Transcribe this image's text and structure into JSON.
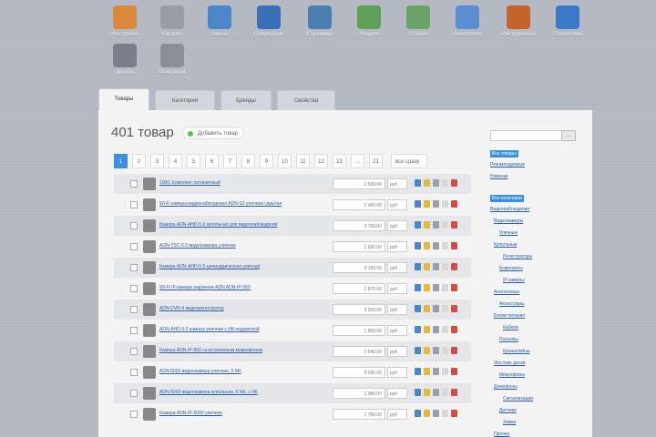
{
  "toolbar": {
    "apps": [
      {
        "label": "Настройки",
        "icon": "settings-user-icon",
        "color": "#d98a3c"
      },
      {
        "label": "Каталог",
        "icon": "catalog-box-icon",
        "color": "#9a9da5"
      },
      {
        "label": "Заказы",
        "icon": "orders-icon",
        "color": "#4a86c8"
      },
      {
        "label": "Покупатели",
        "icon": "users-icon",
        "color": "#3b6fb8"
      },
      {
        "label": "Страницы",
        "icon": "pages-icon",
        "color": "#4b7fb0"
      },
      {
        "label": "Модули",
        "icon": "modules-icon",
        "color": "#5fa05a"
      },
      {
        "label": "Статьи",
        "icon": "articles-icon",
        "color": "#6aa36a"
      },
      {
        "label": "Аналитика",
        "icon": "analytics-icon",
        "color": "#5a8ed0"
      },
      {
        "label": "Инструменты",
        "icon": "tools-icon",
        "color": "#c4642c"
      },
      {
        "label": "Статистика",
        "icon": "stats-icon",
        "color": "#3a78c8"
      },
      {
        "label": "Дизайн",
        "icon": "design-icon",
        "color": "#7a7f8c"
      },
      {
        "label": "Резервная",
        "icon": "backup-icon",
        "color": "#8a8e98"
      }
    ]
  },
  "tabs": [
    {
      "label": "Товары",
      "active": true
    },
    {
      "label": "Категории",
      "active": false
    },
    {
      "label": "Бренды",
      "active": false
    },
    {
      "label": "Свойства",
      "active": false
    }
  ],
  "main": {
    "title": "401 товар",
    "add_label": "Добавить товар",
    "pager": {
      "pages": [
        "1",
        "2",
        "3",
        "4",
        "5",
        "6",
        "7",
        "8",
        "9",
        "10",
        "11",
        "12",
        "13",
        "...",
        "21"
      ],
      "current": "1",
      "select_label": "все сразу"
    },
    "products": [
      {
        "name": "1000, Комплект гостиничный",
        "price": "1 500.00",
        "currency": "руб"
      },
      {
        "name": "Wi-Fi камера видеонаблюдения ADN-S2 уличная скрытая",
        "price": "2 490.00",
        "currency": "руб"
      },
      {
        "name": "Камера ADN-AHD-5.0 купольная для видеонаблюдения",
        "price": "3 700.00",
        "currency": "руб"
      },
      {
        "name": "ADN-YSC-5.0 видеокамера уличная",
        "price": "1 990.00",
        "currency": "руб"
      },
      {
        "name": "Камера ADN-AHD-5.0 цилиндрическая уличная",
        "price": "2 150.00",
        "currency": "руб"
      },
      {
        "name": "Wi-Fi IP камера наружная ADN ADN-IP-550",
        "price": "2 870.00",
        "currency": "руб"
      },
      {
        "name": "ADN-DVR-4 видеорегистратор",
        "price": "3 200.00",
        "currency": "руб"
      },
      {
        "name": "ADN-AHD-5.0 камера уличная с ИК-подсветкой",
        "price": "1 850.00",
        "currency": "руб"
      },
      {
        "name": "Камера ADN-IP-550 со встроенным микрофоном",
        "price": "2 640.00",
        "currency": "руб"
      },
      {
        "name": "ADN-5000 видеокамера уличная, 5 Мп",
        "price": "3 090.00",
        "currency": "руб"
      },
      {
        "name": "ADN-5000 видеокамера купольная, 5 Мп, с ИК",
        "price": "2 980.00",
        "currency": "руб"
      },
      {
        "name": "Камера ADN-IP-5000 уличная",
        "price": "1 760.00",
        "currency": "руб"
      }
    ]
  },
  "sidebar": {
    "search_placeholder": "",
    "search_button": "→",
    "groups": [
      {
        "label": "Все товары",
        "hl": true
      },
      {
        "label": "Рекомендуемые",
        "hl": false
      },
      {
        "label": "Новинки",
        "hl": false
      },
      {
        "label": "Все категории",
        "hl": true
      },
      {
        "label": "Видеонаблюдение",
        "hl": false
      },
      {
        "label": "Видеокамеры",
        "hl": false
      },
      {
        "label": "Уличные",
        "hl": false
      },
      {
        "label": "Купольные",
        "hl": false
      },
      {
        "label": "Регистраторы",
        "hl": false
      },
      {
        "label": "Комплекты",
        "hl": false
      },
      {
        "label": "IP камеры",
        "hl": false
      },
      {
        "label": "Аналоговые",
        "hl": false
      },
      {
        "label": "Аксессуары",
        "hl": false
      },
      {
        "label": "Блоки питания",
        "hl": false
      },
      {
        "label": "Кабели",
        "hl": false
      },
      {
        "label": "Разъемы",
        "hl": false
      },
      {
        "label": "Кронштейны",
        "hl": false
      },
      {
        "label": "Жесткие диски",
        "hl": false
      },
      {
        "label": "Микрофоны",
        "hl": false
      },
      {
        "label": "Домофоны",
        "hl": false
      },
      {
        "label": "Сигнализации",
        "hl": false
      },
      {
        "label": "Датчики",
        "hl": false
      },
      {
        "label": "Замки",
        "hl": false
      },
      {
        "label": "Прочее",
        "hl": false
      }
    ]
  }
}
